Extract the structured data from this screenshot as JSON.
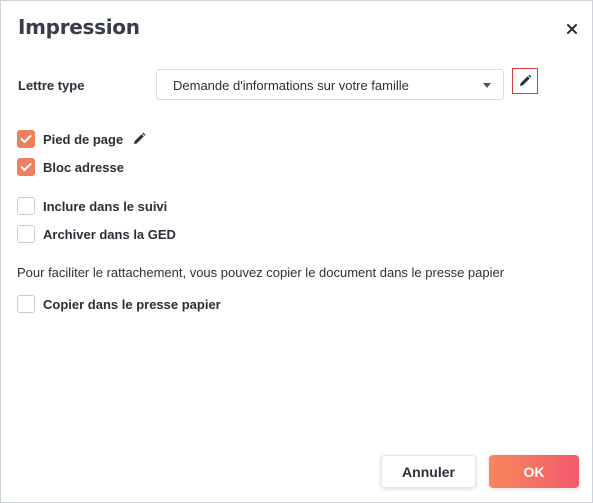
{
  "dialog": {
    "title": "Impression",
    "close_icon": "close-icon"
  },
  "lettre_type": {
    "label": "Lettre type",
    "selected": "Demande d'informations sur votre famille",
    "edit_icon": "pencil-icon"
  },
  "options": {
    "pied_de_page": {
      "label": "Pied de page",
      "checked": true
    },
    "bloc_adresse": {
      "label": "Bloc adresse",
      "checked": true
    },
    "inclure_suivi": {
      "label": "Inclure dans le suivi",
      "checked": false
    },
    "archiver_ged": {
      "label": "Archiver dans la GED",
      "checked": false
    }
  },
  "clipboard": {
    "info": "Pour faciliter le rattachement, vous pouvez copier le document dans le presse papier",
    "label": "Copier dans le presse papier",
    "checked": false
  },
  "footer": {
    "cancel_label": "Annuler",
    "ok_label": "OK"
  },
  "colors": {
    "accent": "#f07f5d",
    "ok_gradient_start": "#f7875a",
    "ok_gradient_end": "#f25a6e",
    "edit_border": "#d53a3a"
  }
}
